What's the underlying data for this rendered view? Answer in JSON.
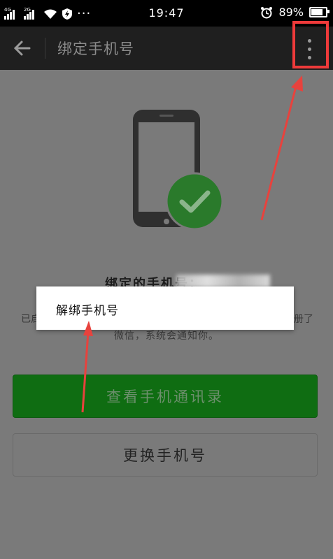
{
  "status_bar": {
    "time": "19:47",
    "battery": "89%",
    "battery_level": 0.89,
    "signal_1_label": "4G",
    "signal_2_label": "2G",
    "more_indicator": "···",
    "icons": [
      "signal-icon",
      "signal-icon",
      "wifi-icon",
      "shield-icon",
      "alarm-icon",
      "battery-icon"
    ]
  },
  "titlebar": {
    "title": "绑定手机号",
    "back_icon": "arrow-left-icon",
    "more_icon": "more-vertical-icon"
  },
  "content": {
    "bind_label": "绑定的手机号：",
    "desc_left": "已启",
    "desc_right": "册了",
    "desc_line2": "微信，系统会通知你。"
  },
  "buttons": {
    "view_contacts": "查看手机通讯录",
    "change_phone": "更换手机号"
  },
  "popup": {
    "unbind": "解绑手机号"
  },
  "colors": {
    "primary_green": "#0f6d12",
    "check_green": "#2a7a2b",
    "annotation_red": "#ee3a3a"
  }
}
